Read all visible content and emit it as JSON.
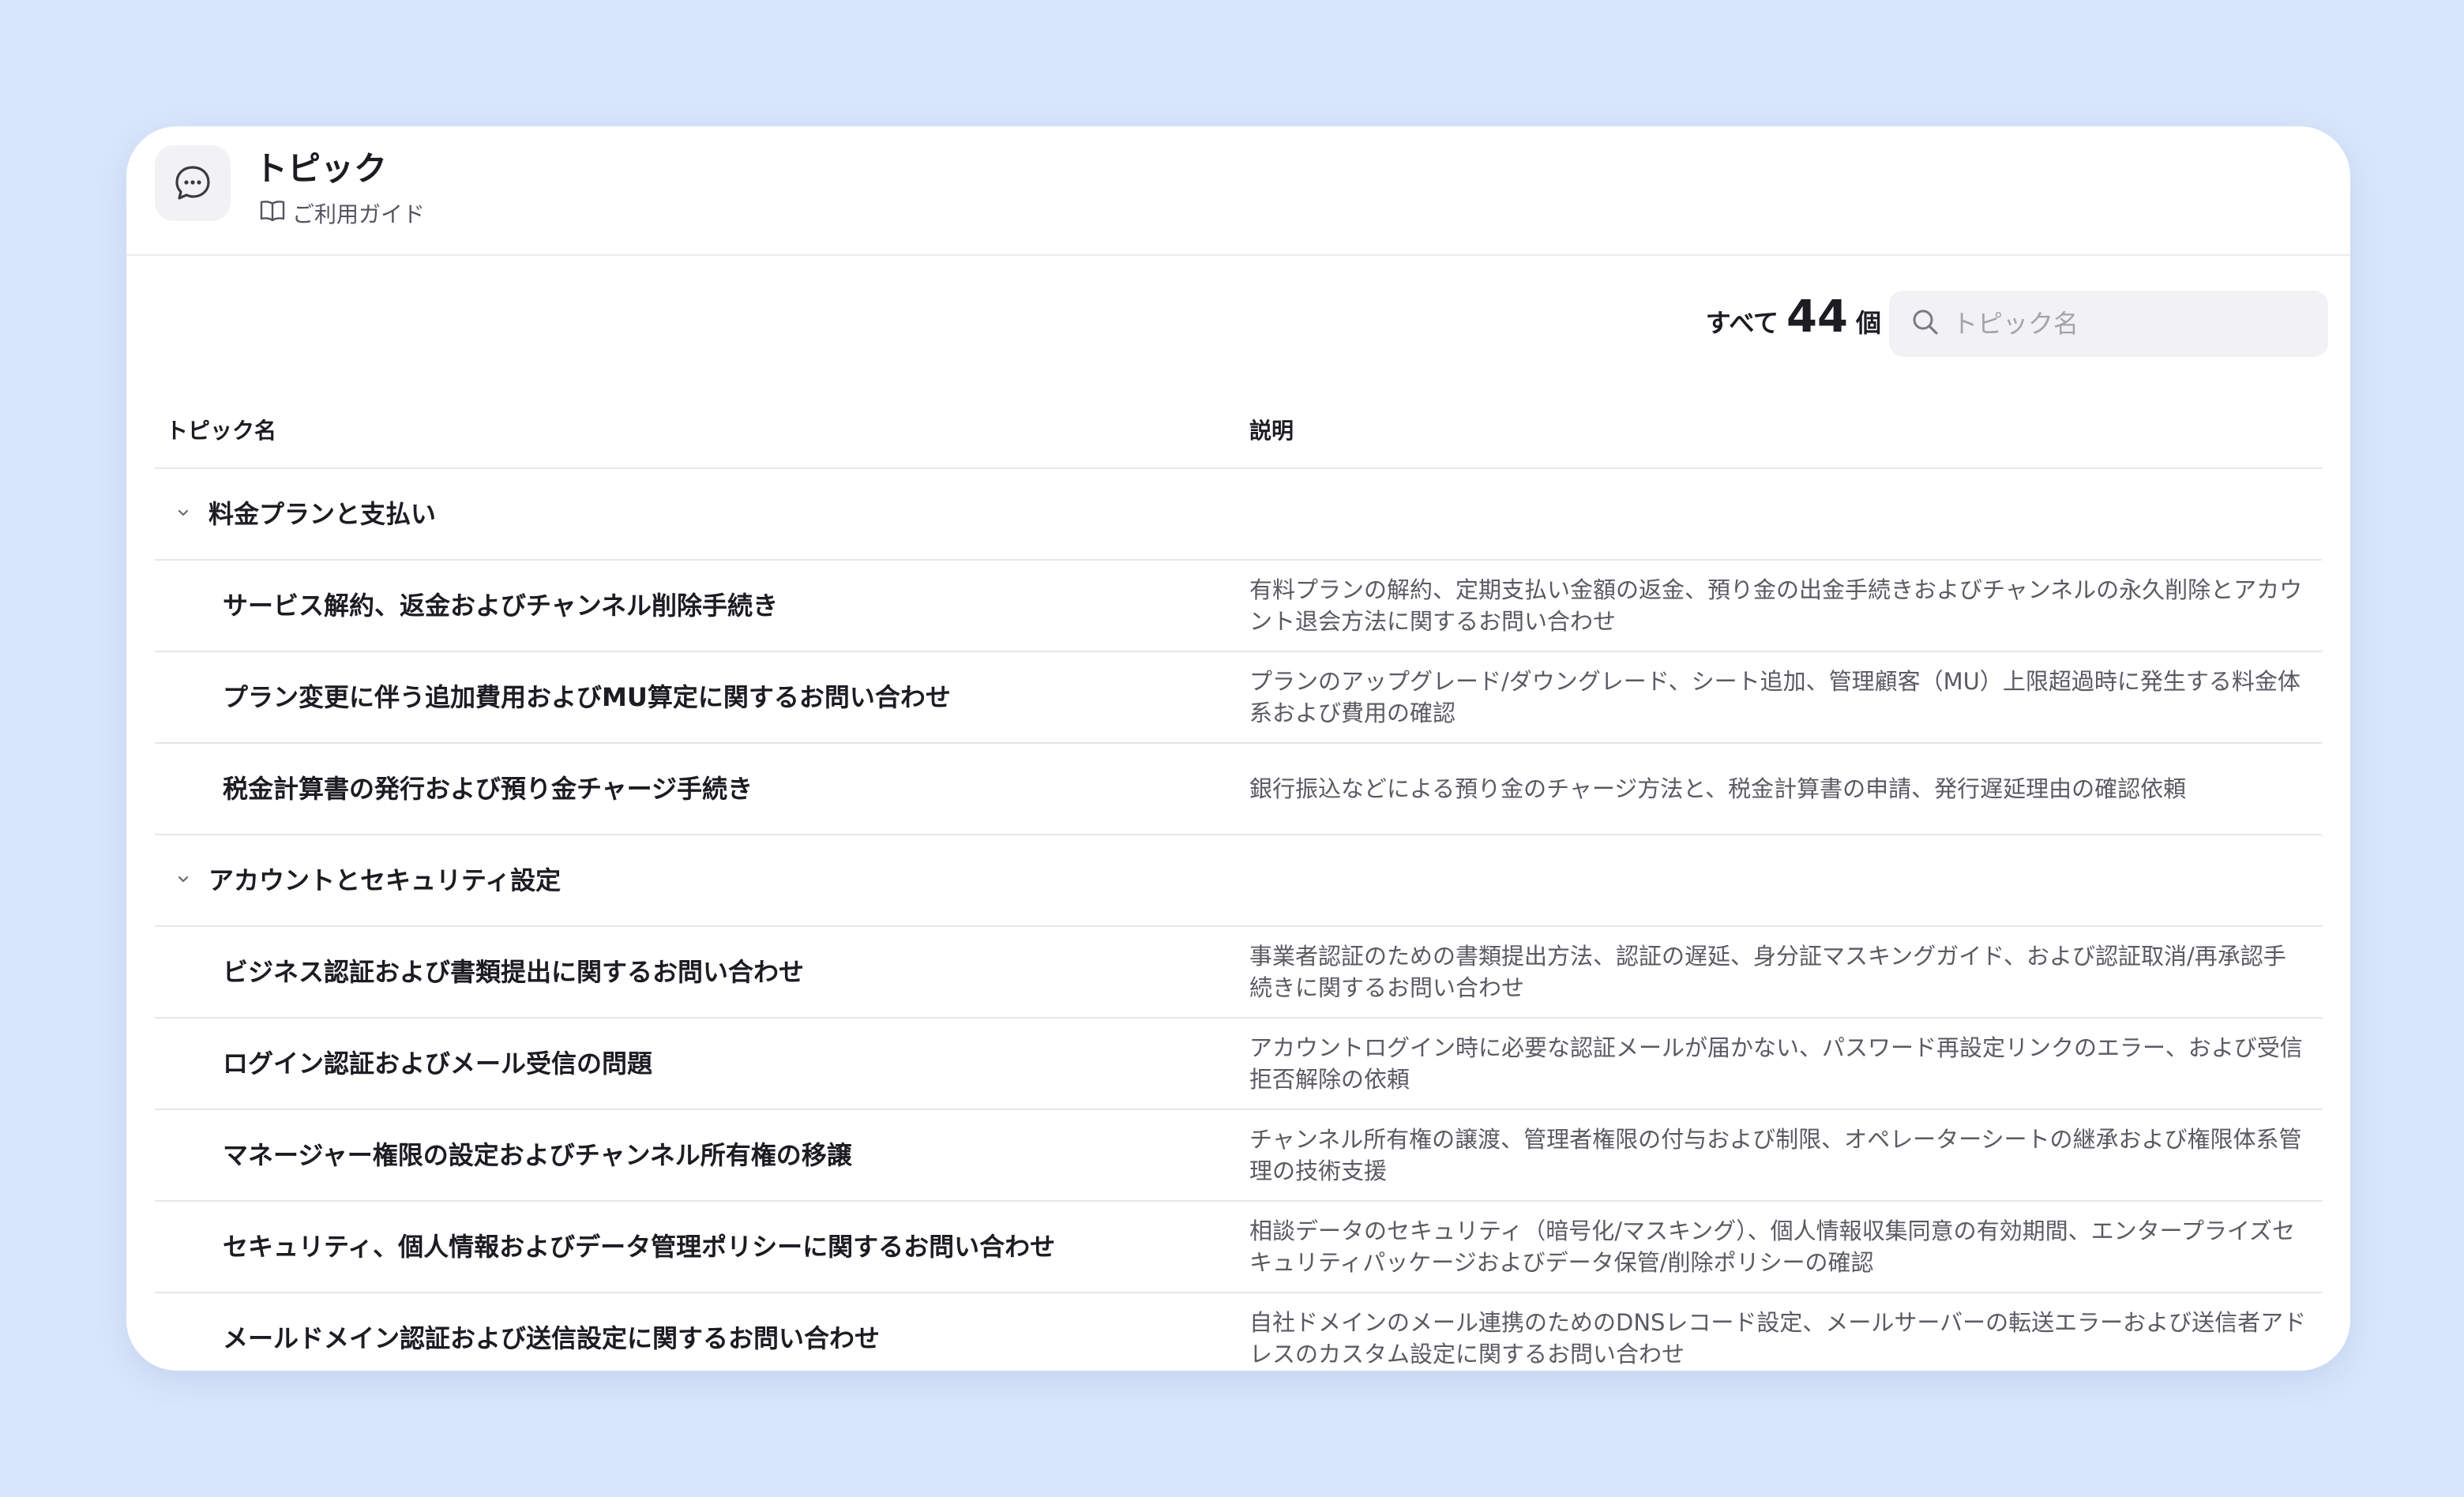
{
  "header": {
    "title": "トピック",
    "guide_label": "ご利用ガイド"
  },
  "summary": {
    "prefix": "すべて",
    "count": "44",
    "suffix": "個"
  },
  "search": {
    "placeholder": "トピック名",
    "value": ""
  },
  "table": {
    "headers": [
      "トピック名",
      "説明"
    ]
  },
  "groups": [
    {
      "name": "料金プランと支払い",
      "topics": [
        {
          "name": "サービス解約、返金およびチャンネル削除手続き",
          "desc": "有料プランの解約、定期支払い金額の返金、預り金の出金手続きおよびチャンネルの永久削除とアカウント退会方法に関するお問い合わせ"
        },
        {
          "name": "プラン変更に伴う追加費用およびMU算定に関するお問い合わせ",
          "desc": "プランのアップグレード/ダウングレード、シート追加、管理顧客（MU）上限超過時に発生する料金体系および費用の確認"
        },
        {
          "name": "税金計算書の発行および預り金チャージ手続き",
          "desc": "銀行振込などによる預り金のチャージ方法と、税金計算書の申請、発行遅延理由の確認依頼"
        }
      ]
    },
    {
      "name": "アカウントとセキュリティ設定",
      "topics": [
        {
          "name": "ビジネス認証および書類提出に関するお問い合わせ",
          "desc": "事業者認証のための書類提出方法、認証の遅延、身分証マスキングガイド、および認証取消/再承認手続きに関するお問い合わせ"
        },
        {
          "name": "ログイン認証およびメール受信の問題",
          "desc": "アカウントログイン時に必要な認証メールが届かない、パスワード再設定リンクのエラー、および受信拒否解除の依頼"
        },
        {
          "name": "マネージャー権限の設定およびチャンネル所有権の移譲",
          "desc": "チャンネル所有権の譲渡、管理者権限の付与および制限、オペレーターシートの継承および権限体系管理の技術支援"
        },
        {
          "name": "セキュリティ、個人情報およびデータ管理ポリシーに関するお問い合わせ",
          "desc": "相談データのセキュリティ（暗号化/マスキング）、個人情報収集同意の有効期間、エンタープライズセキュリティパッケージおよびデータ保管/削除ポリシーの確認"
        },
        {
          "name": "メールドメイン認証および送信設定に関するお問い合わせ",
          "desc": "自社ドメインのメール連携のためのDNSレコード設定、メールサーバーの転送エラーおよび送信者アドレスのカスタム設定に関するお問い合わせ"
        }
      ]
    }
  ]
}
